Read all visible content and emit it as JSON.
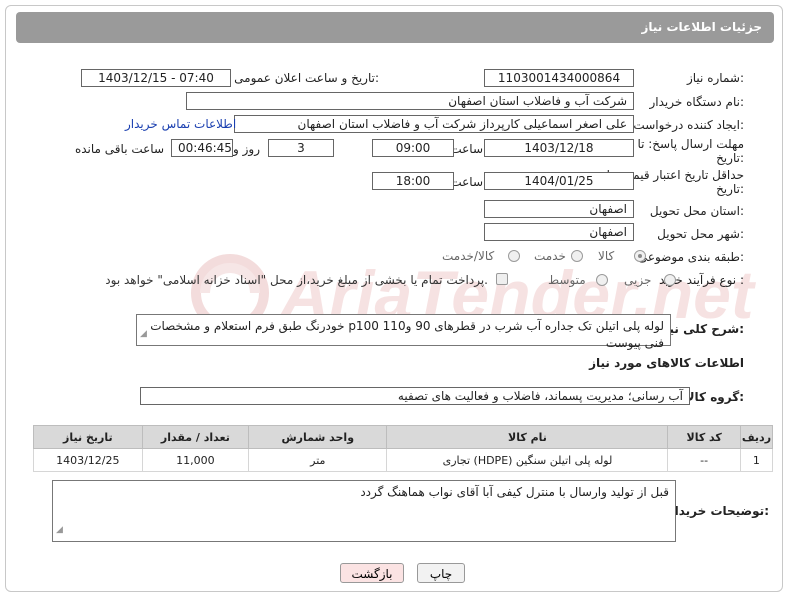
{
  "title": "جزئیات اطلاعات نیاز",
  "fields": {
    "need_number_label": "شماره نیاز:",
    "need_number": "1103001434000864",
    "announce_label": "تاریخ و ساعت اعلان عمومی:",
    "announce_value": "1403/12/15 - 07:40",
    "buyer_label": "نام دستگاه خریدار:",
    "buyer_value": "شرکت آب و فاضلاب استان اصفهان",
    "creator_label": "ایجاد کننده درخواست:",
    "creator_value": "علی اصغر اسماعیلی کارپرداز شرکت آب و فاضلاب استان اصفهان",
    "contact_link": "اطلاعات تماس خریدار",
    "reply_label_1": "مهلت ارسال پاسخ: تا",
    "reply_label_2": "تاریخ:",
    "reply_date": "1403/12/18",
    "time_label": "ساعت",
    "reply_time": "09:00",
    "reply_days": "3",
    "day_label": "روز و",
    "remaining_time": "00:46:45",
    "remaining_label": "ساعت باقی مانده",
    "validity_label_1": "حداقل تاریخ اعتبار قیمت: تا",
    "validity_label_2": "تاریخ:",
    "validity_date": "1404/01/25",
    "validity_time": "18:00",
    "province_label": "استان محل تحویل:",
    "province_value": "اصفهان",
    "city_label": "شهر محل تحویل:",
    "city_value": "اصفهان",
    "category_label": "طبقه بندی موضوعی:",
    "category_options": [
      "کالا",
      "خدمت",
      "کالا/خدمت"
    ],
    "category_selected": "کالا",
    "process_label": "نوع فرآیند خرید :",
    "process_options": [
      "جزیی",
      "متوسط"
    ],
    "payment_note": "پرداخت تمام یا بخشی از مبلغ خرید،از محل \"اسناد خزانه اسلامی\" خواهد بود.",
    "desc_label": "شرح کلی نیاز:",
    "desc_value": "لوله پلی اتیلن تک جداره آب شرب در قطرهای 90 و110 p100 خودرنگ طبق فرم استعلام و مشخصات فنی پیوست",
    "goods_info_label": "اطلاعات کالاهای مورد نیاز",
    "goods_group_label": "گروه کالا:",
    "goods_group_value": "آب رسانی؛ مدیریت پسماند، فاضلاب و فعالیت های تصفیه",
    "buyer_notes_label": "توضیحات خریدار:",
    "buyer_notes_value": "قبل از تولید وارسال با منترل کیفی آبا آقای نواب هماهنگ گردد"
  },
  "table": {
    "headers": [
      "ردیف",
      "کد کالا",
      "نام کالا",
      "واحد شمارش",
      "تعداد / مقدار",
      "تاریخ نیاز"
    ],
    "rows": [
      [
        "1",
        "--",
        "لوله پلی اتیلن سنگین (HDPE) تجاری",
        "متر",
        "11,000",
        "1403/12/25"
      ]
    ]
  },
  "buttons": {
    "print": "چاپ",
    "back": "بازگشت"
  },
  "watermark_text": "AriaTender.net",
  "colors": {
    "titlebar": "#9a9a9a",
    "link": "#1a3fb0",
    "back_button_bg": "#fbe3e3"
  }
}
